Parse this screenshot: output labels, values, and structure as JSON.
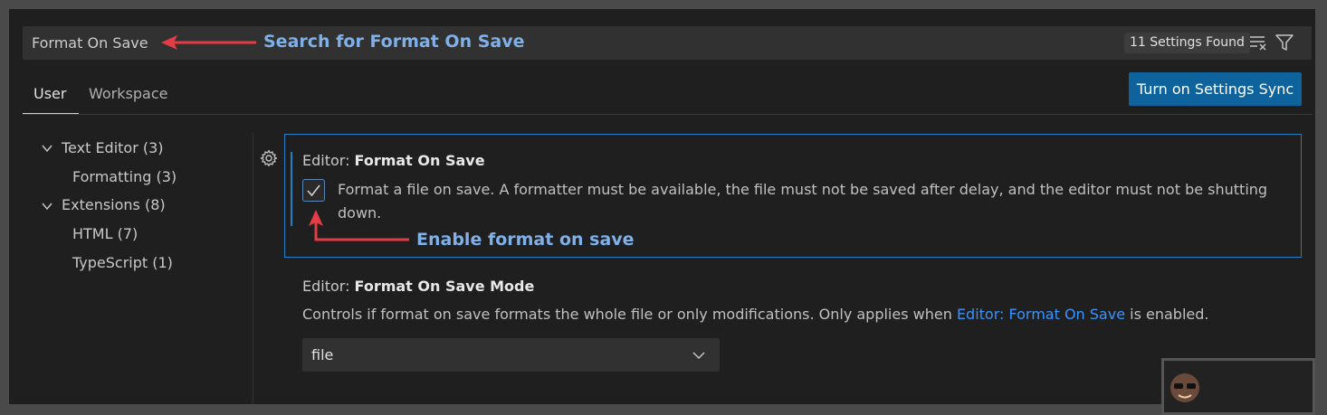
{
  "search": {
    "value": "Format On Save",
    "found_label": "11 Settings Found"
  },
  "tabs": [
    {
      "label": "User"
    },
    {
      "label": "Workspace"
    }
  ],
  "sync_button_label": "Turn on Settings Sync",
  "toc": [
    {
      "label": "Text Editor (3)"
    },
    {
      "label": "Formatting (3)"
    },
    {
      "label": "Extensions (8)"
    },
    {
      "label": "HTML (7)"
    },
    {
      "label": "TypeScript (1)"
    }
  ],
  "settings": [
    {
      "category": "Editor: ",
      "name": "Format On Save",
      "checked": true,
      "description_line1": "Format a file on save. A formatter must be available, the file must not be saved after delay, and the editor must not be shutting",
      "description_line2": "down."
    },
    {
      "category": "Editor: ",
      "name": "Format On Save Mode",
      "description_before": "Controls if format on save formats the whole file or only modifications. Only applies when ",
      "description_link": "Editor: Format On Save",
      "description_after": " is enabled.",
      "dropdown_value": "file"
    }
  ],
  "annotations": {
    "search_hint": "Search for Format On Save",
    "enable_hint": "Enable format on save"
  },
  "colors": {
    "accent": "#1b80c4",
    "button": "#0e639c",
    "link": "#3794ff",
    "annotation_arrow": "#e23c45",
    "annotation_text": "#7fb0e8"
  }
}
